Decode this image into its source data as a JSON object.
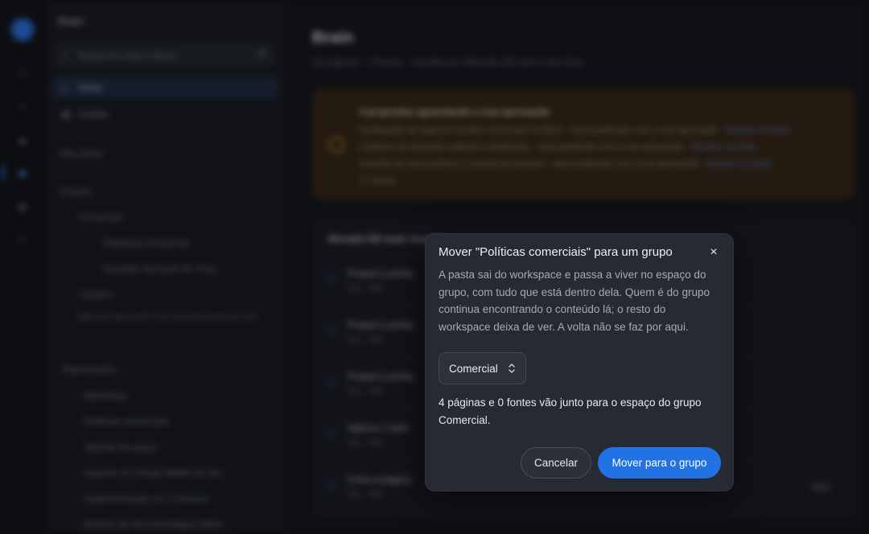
{
  "colors": {
    "accent": "#2272e4",
    "dialog_bg": "#262a34",
    "background": "#14161c",
    "warning_bg": "#3a2a1b"
  },
  "background_app": {
    "sidebar": {
      "title": "Brain",
      "search_placeholder": "Busca em todo o Brain",
      "items": [
        {
          "label": "Início",
          "icon": "home-icon"
        },
        {
          "label": "Fontes",
          "icon": "sources-icon"
        }
      ],
      "sections": [
        {
          "label": "Meu Brain"
        },
        {
          "label": "Grupos"
        },
        {
          "label": "Comercial"
        },
        {
          "label": "Jurídico"
        },
        {
          "label": "Organização"
        }
      ],
      "group_items": [
        "Playbook Comercial",
        "Reunião Semanal do Time"
      ],
      "note": "Nada por aqui ainda. Crie a primeira pasta do time.",
      "org_items": [
        "Marketing",
        "Políticas comerciais",
        "Tabelas de preço",
        "Impacto no Tempo Médio de Re...",
        "Implementação em 3 Passos",
        "Modelo de Ata Estratégica (Mod..."
      ]
    },
    "main": {
      "title": "Brain",
      "subtitle": "16 páginas · 3 fontes · mantida por Moradei EB com o seu time",
      "alert": {
        "title": "3 propostas aguardando a sua aprovação",
        "lines": [
          "Atualização da regra de vendas comerciais no Brain · seria publicada com a sua aprovação",
          "Cadastro de operação artificial e atualizada · seria publicada com a sua aprovação",
          "Inclusão de nova política e controle de primeiro · seria publicada com a sua aprovação"
        ],
        "link": "Revisar na fonte",
        "more": "+1 outras"
      },
      "list": {
        "header": "Moradei EB mais recentes",
        "rows": [
          {
            "title": "Projeto Lumina",
            "meta": "12h · Vall"
          },
          {
            "title": "Projeto Lumina",
            "meta": "12h · Vall"
          },
          {
            "title": "Projeto Lumina",
            "meta": "12h · Vall"
          },
          {
            "title": "Aplicou 1 item",
            "meta": "12h · Vall"
          },
          {
            "title": "Criou a página",
            "meta": "12h · Vall"
          }
        ],
        "tag": "Abrir"
      }
    }
  },
  "dialog": {
    "title": "Mover \"Políticas comerciais\" para um grupo",
    "body": "A pasta sai do workspace e passa a viver no espaço do grupo, com tudo que está dentro dela. Quem é do grupo continua encontrando o conteúdo lá; o resto do workspace deixa de ver. A volta não se faz por aqui.",
    "select_value": "Comercial",
    "info": "4 páginas e 0 fontes vão junto para o espaço do grupo Comercial.",
    "cancel_label": "Cancelar",
    "confirm_label": "Mover para o grupo",
    "close_icon": "×"
  }
}
